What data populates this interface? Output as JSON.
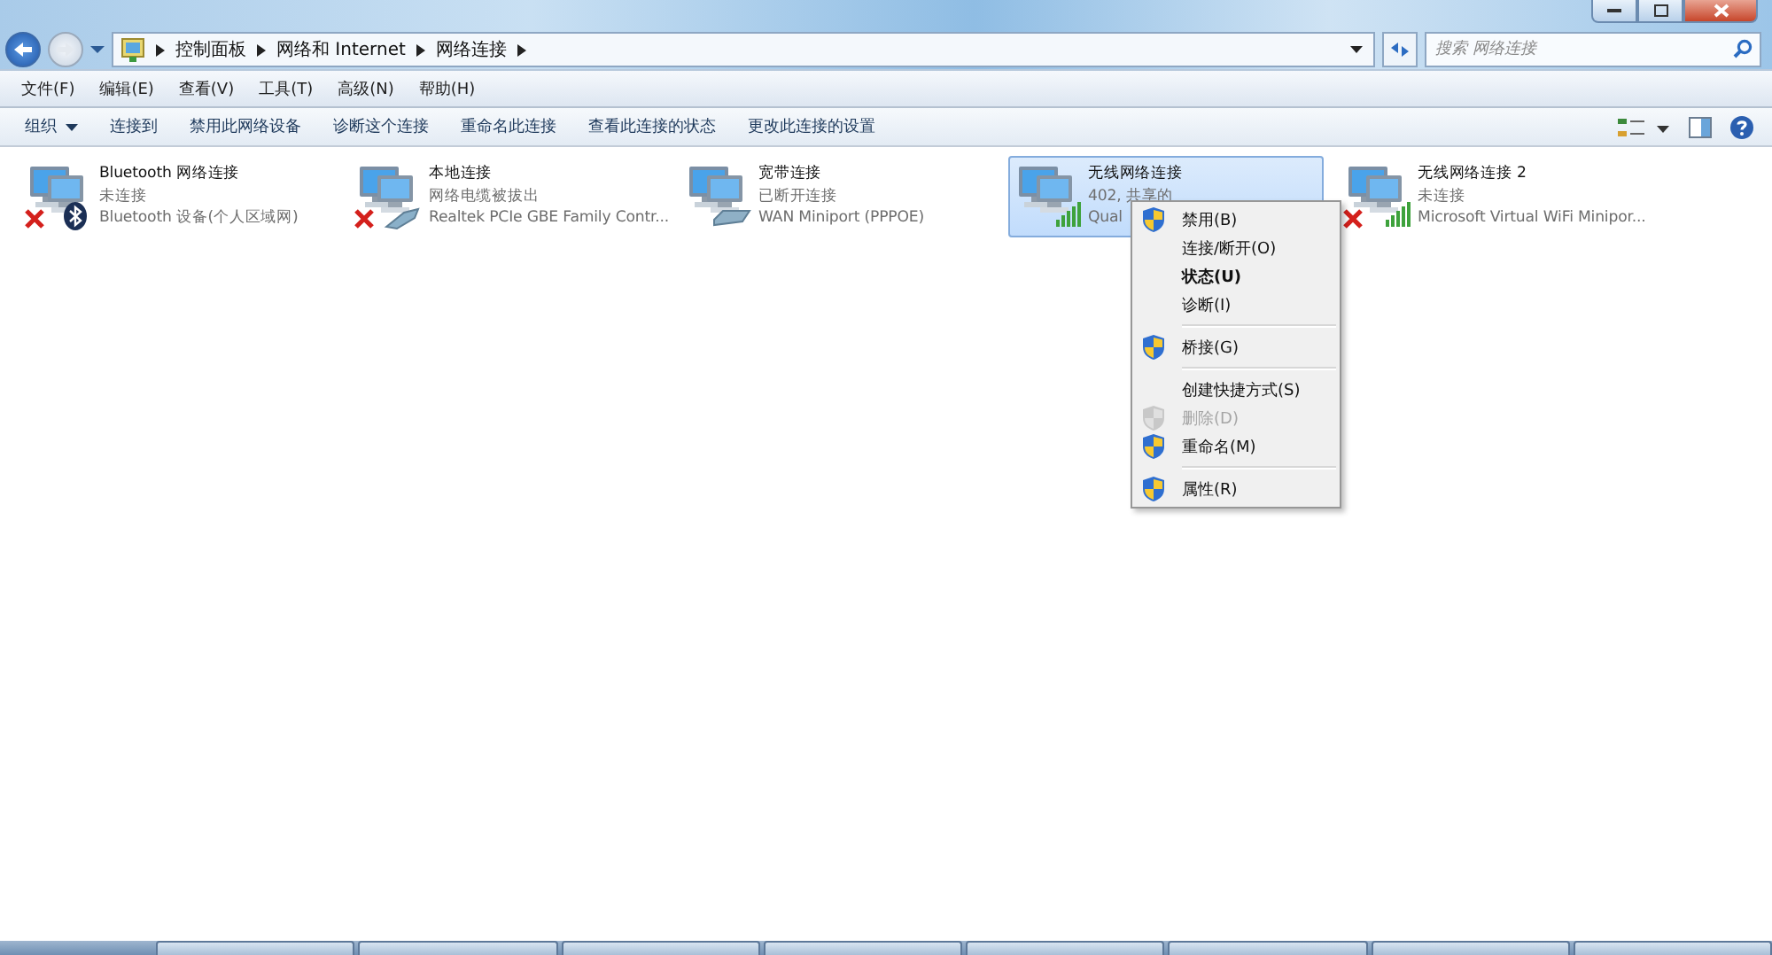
{
  "address_bar": {
    "segments": [
      "控制面板",
      "网络和 Internet",
      "网络连接"
    ]
  },
  "search": {
    "placeholder": "搜索 网络连接"
  },
  "menu_bar": [
    "文件(F)",
    "编辑(E)",
    "查看(V)",
    "工具(T)",
    "高级(N)",
    "帮助(H)"
  ],
  "toolbar": [
    {
      "label": "组织",
      "kind": "dropdown"
    },
    {
      "label": "连接到",
      "kind": "plain"
    },
    {
      "label": "禁用此网络设备",
      "kind": "plain"
    },
    {
      "label": "诊断这个连接",
      "kind": "plain"
    },
    {
      "label": "重命名此连接",
      "kind": "plain"
    },
    {
      "label": "查看此连接的状态",
      "kind": "plain"
    },
    {
      "label": "更改此连接的设置",
      "kind": "plain"
    }
  ],
  "connections": [
    {
      "name": "Bluetooth 网络连接",
      "status": "未连接",
      "device": "Bluetooth 设备(个人区域网)",
      "kind": "bluetooth",
      "disconnected": true,
      "selected": false
    },
    {
      "name": "本地连接",
      "status": "网络电缆被拔出",
      "device": "Realtek PCIe GBE Family Contr...",
      "kind": "cable",
      "disconnected": true,
      "selected": false
    },
    {
      "name": "宽带连接",
      "status": "已断开连接",
      "device": "WAN Miniport (PPPOE)",
      "kind": "modem",
      "disconnected": false,
      "selected": false
    },
    {
      "name": "无线网络连接",
      "status": "402, 共享的",
      "device": "Qual",
      "kind": "wireless",
      "disconnected": false,
      "selected": true
    },
    {
      "name": "无线网络连接 2",
      "status": "未连接",
      "device": "Microsoft Virtual WiFi Minipor...",
      "kind": "wireless",
      "disconnected": true,
      "selected": false
    }
  ],
  "context_menu": {
    "groups": [
      [
        {
          "label": "禁用(B)",
          "shield": true,
          "bold": false,
          "disabled": false
        },
        {
          "label": "连接/断开(O)",
          "shield": false,
          "bold": false,
          "disabled": false
        },
        {
          "label": "状态(U)",
          "shield": false,
          "bold": true,
          "disabled": false
        },
        {
          "label": "诊断(I)",
          "shield": false,
          "bold": false,
          "disabled": false
        }
      ],
      [
        {
          "label": "桥接(G)",
          "shield": true,
          "bold": false,
          "disabled": false
        }
      ],
      [
        {
          "label": "创建快捷方式(S)",
          "shield": false,
          "bold": false,
          "disabled": false
        },
        {
          "label": "删除(D)",
          "shield": true,
          "bold": false,
          "disabled": true
        },
        {
          "label": "重命名(M)",
          "shield": true,
          "bold": false,
          "disabled": false
        }
      ],
      [
        {
          "label": "属性(R)",
          "shield": true,
          "bold": false,
          "disabled": false
        }
      ]
    ]
  }
}
